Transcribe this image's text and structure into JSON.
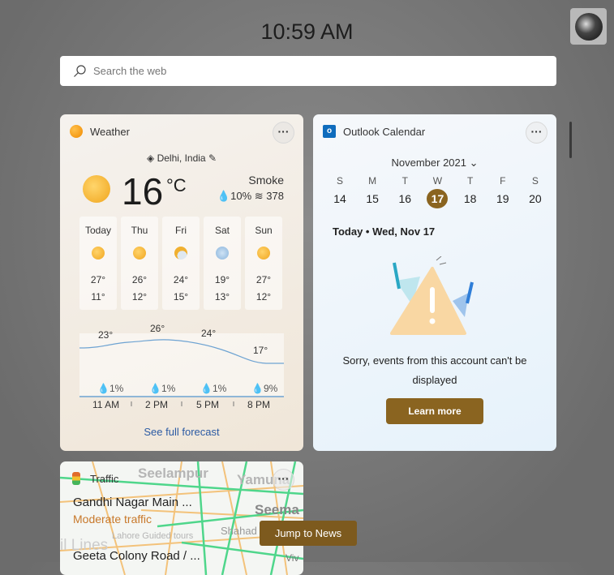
{
  "time": "10:59 AM",
  "search": {
    "placeholder": "Search the web"
  },
  "weather": {
    "title": "Weather",
    "more": "···",
    "location": "Delhi, India",
    "temp": "16",
    "unit": "°C",
    "condition": "Smoke",
    "precip": "10%",
    "aqi": "378",
    "days": [
      {
        "name": "Today",
        "hi": "27°",
        "lo": "11°",
        "icon": "sunny"
      },
      {
        "name": "Thu",
        "hi": "26°",
        "lo": "12°",
        "icon": "partly-sunny"
      },
      {
        "name": "Fri",
        "hi": "24°",
        "lo": "15°",
        "icon": "partly-cloudy"
      },
      {
        "name": "Sat",
        "hi": "19°",
        "lo": "13°",
        "icon": "rain-showers"
      },
      {
        "name": "Sun",
        "hi": "27°",
        "lo": "12°",
        "icon": "sunny"
      }
    ],
    "hourly": [
      {
        "time": "11 AM",
        "temp": "23°",
        "rain": "1%"
      },
      {
        "time": "2 PM",
        "temp": "26°",
        "rain": "1%"
      },
      {
        "time": "5 PM",
        "temp": "24°",
        "rain": "1%"
      },
      {
        "time": "8 PM",
        "temp": "17°",
        "rain": "9%"
      }
    ],
    "link": "See full forecast"
  },
  "calendar": {
    "title": "Outlook Calendar",
    "more": "···",
    "month": "November 2021",
    "weekdays": [
      "S",
      "M",
      "T",
      "W",
      "T",
      "F",
      "S"
    ],
    "dates": [
      "14",
      "15",
      "16",
      "17",
      "18",
      "19",
      "20"
    ],
    "selected": "17",
    "today": "Today • Wed, Nov 17",
    "error": "Sorry, events from this account can't be displayed",
    "button": "Learn more",
    "accent": "#8a6420"
  },
  "traffic": {
    "title": "Traffic",
    "more": "···",
    "routes": [
      {
        "name": "Gandhi Nagar Main ...",
        "status": "Moderate traffic"
      },
      {
        "name": "Geeta Colony Road / ..."
      }
    ],
    "map_labels": [
      "Seelampur",
      "Yamuna",
      "Seema",
      "Shahad",
      "Lahore Guided tours",
      "il Lines",
      "Viv"
    ],
    "status_color": "#c8782a"
  },
  "jump_button": "Jump to News"
}
